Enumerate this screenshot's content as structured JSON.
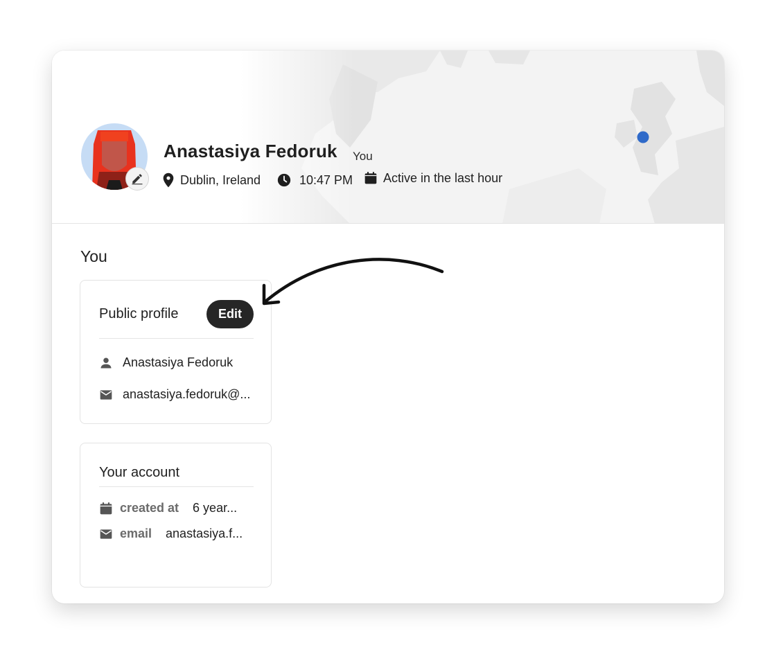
{
  "profile": {
    "name": "Anastasiya Fedoruk",
    "badge": "You",
    "location": "Dublin, Ireland",
    "local_time": "10:47 PM",
    "activity": "Active in the last hour"
  },
  "section": {
    "title": "You"
  },
  "public_profile": {
    "title": "Public profile",
    "edit_label": "Edit",
    "full_name": "Anastasiya Fedoruk",
    "email": "anastasiya.fedoruk@..."
  },
  "account": {
    "title": "Your account",
    "created_label": "created at",
    "created_value": "6 year...",
    "email_label": "email",
    "email_value": "anastasiya.f..."
  },
  "colors": {
    "location_pin": "#2f6ac9",
    "button_bg": "#262626",
    "avatar_bg": "#c6dcf5",
    "avatar_hair": "#e8321e"
  },
  "icons": {
    "avatar_edit": "pencil-icon",
    "location": "map-pin-icon",
    "time": "clock-icon",
    "activity": "calendar-icon",
    "person": "person-icon",
    "email": "mail-icon",
    "created": "calendar-icon"
  }
}
